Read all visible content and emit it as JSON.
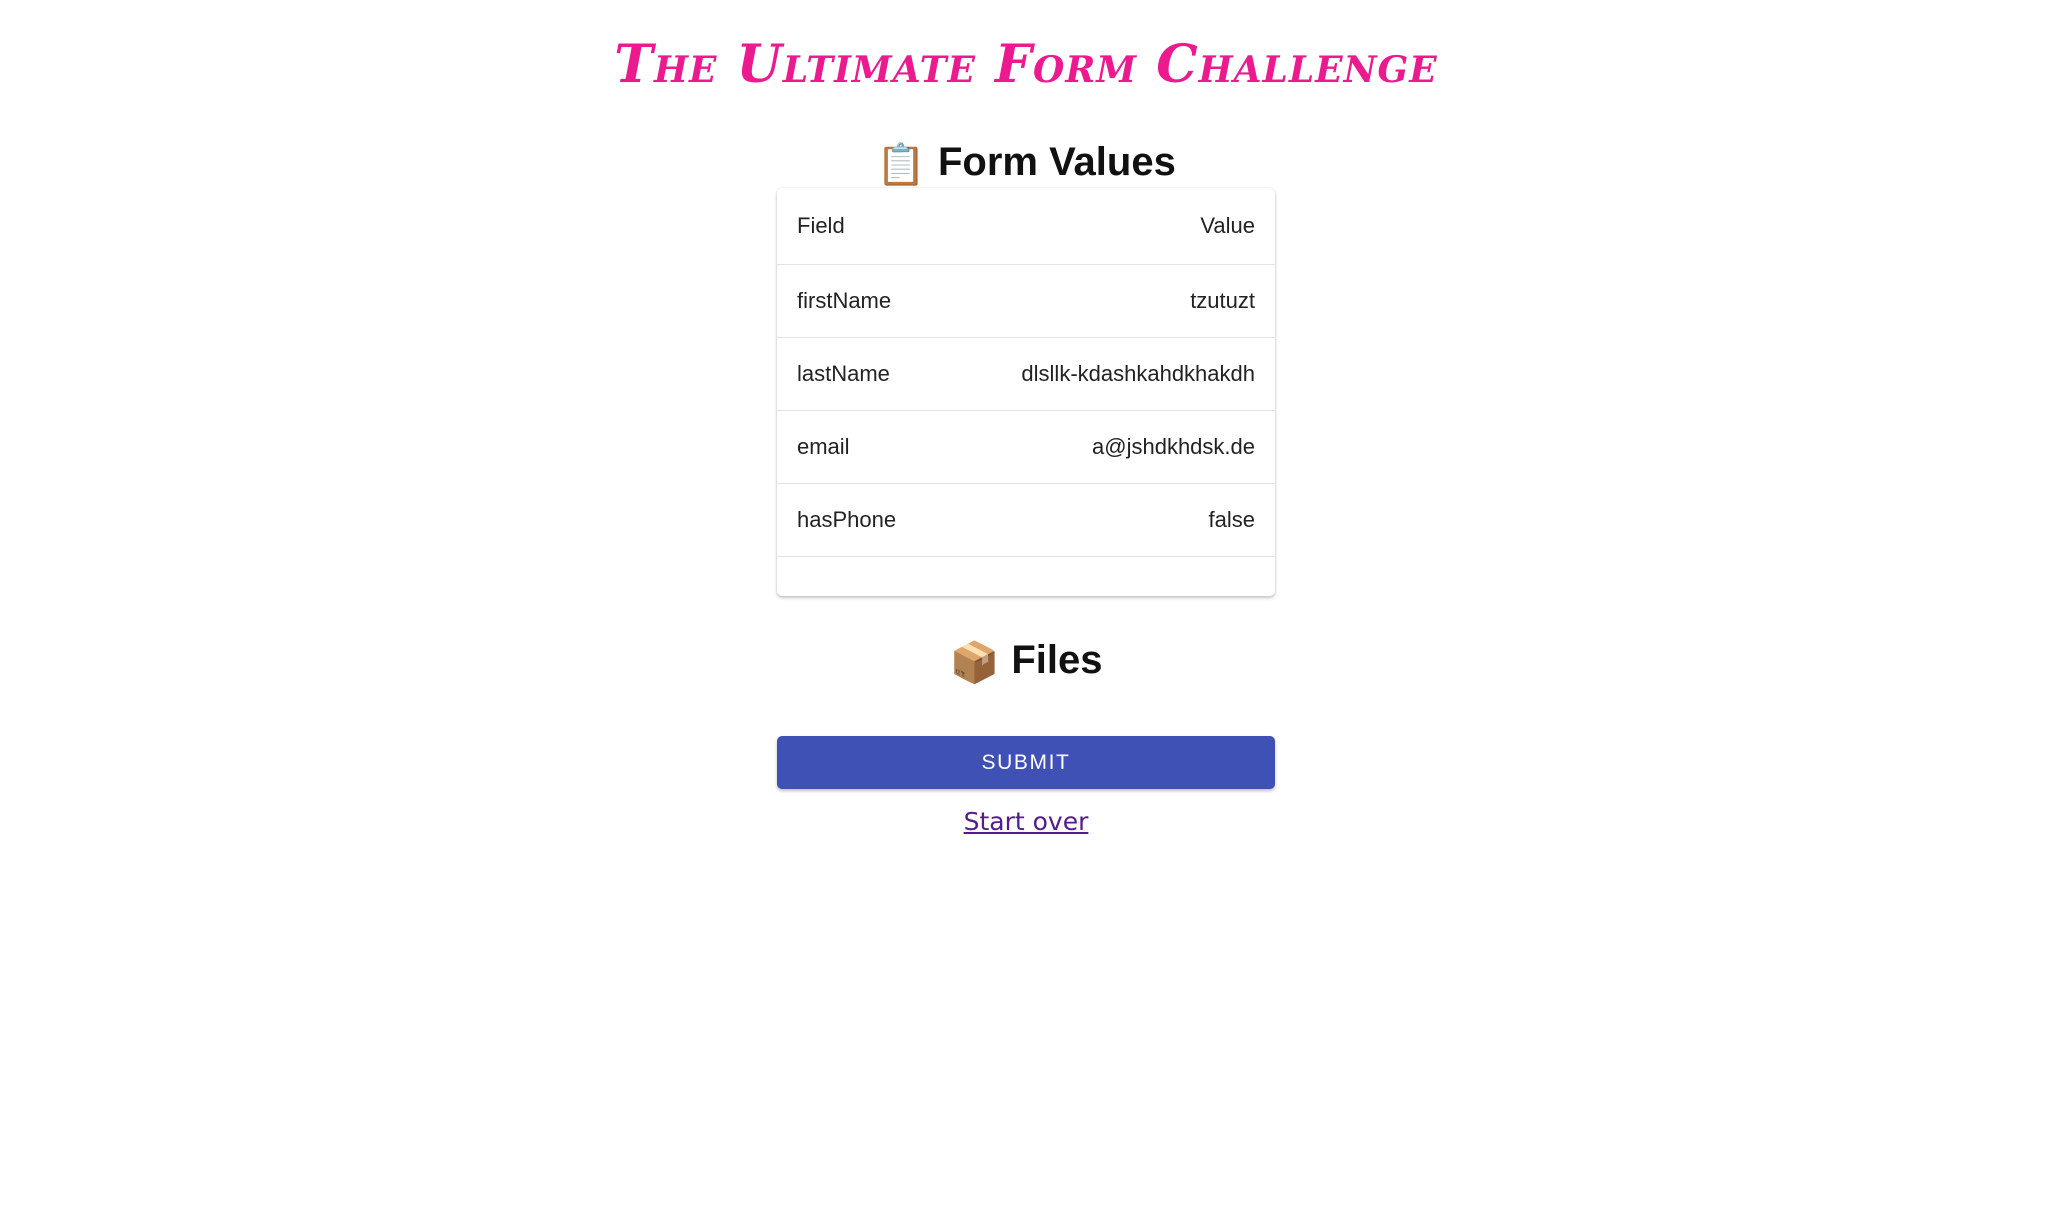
{
  "app": {
    "title": "The Ultimate Form Challenge"
  },
  "form_values": {
    "icon": "clipboard-icon",
    "icon_glyph": "📋",
    "heading": "Form Values",
    "columns": {
      "field": "Field",
      "value": "Value"
    },
    "rows": [
      {
        "field": "firstName",
        "value": "tzutuzt"
      },
      {
        "field": "lastName",
        "value": "dlsllk-kdashkahdkhakdh"
      },
      {
        "field": "email",
        "value": "a@jshdkhdsk.de"
      },
      {
        "field": "hasPhone",
        "value": "false"
      }
    ]
  },
  "files": {
    "icon": "package-icon",
    "icon_glyph": "📦",
    "heading": "Files"
  },
  "actions": {
    "submit_label": "Submit",
    "start_over_label": "Start over"
  },
  "colors": {
    "title": "#ec1a8f",
    "primary": "#3f51b5",
    "link_visited": "#551a8b"
  }
}
